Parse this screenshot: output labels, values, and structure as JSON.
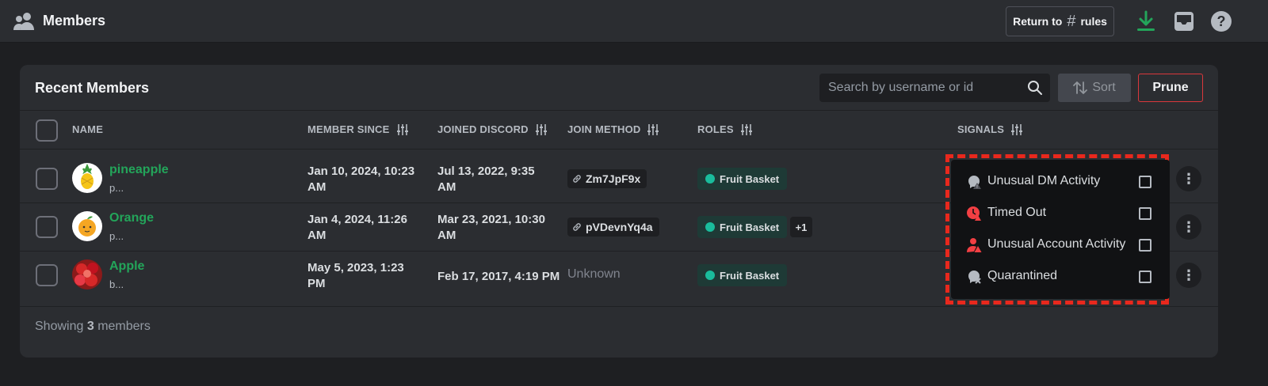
{
  "header": {
    "title": "Members",
    "return_prefix": "Return to",
    "return_channel": "rules",
    "icons": [
      "members-icon",
      "download-icon",
      "inbox-icon",
      "help-icon"
    ]
  },
  "panel": {
    "title": "Recent Members",
    "search_placeholder": "Search by username or id",
    "sort_label": "Sort",
    "prune_label": "Prune"
  },
  "columns": {
    "name": "NAME",
    "member_since": "MEMBER SINCE",
    "joined_discord": "JOINED DISCORD",
    "join_method": "JOIN METHOD",
    "roles": "ROLES",
    "signals": "SIGNALS"
  },
  "rows": [
    {
      "username": "pineapple",
      "subtext": "p...",
      "member_since_1": "Jan 10, 2024, 10:23",
      "member_since_2": "AM",
      "joined_1": "Jul 13, 2022, 9:35",
      "joined_2": "AM",
      "invite": "Zm7JpF9x",
      "role": "Fruit Basket",
      "extra_roles": ""
    },
    {
      "username": "Orange",
      "subtext": "p...",
      "member_since_1": "Jan 4, 2024, 11:26",
      "member_since_2": "AM",
      "joined_1": "Mar 23, 2021, 10:30",
      "joined_2": "AM",
      "invite": "pVDevnYq4a",
      "role": "Fruit Basket",
      "extra_roles": "+1"
    },
    {
      "username": "Apple",
      "subtext": "b...",
      "member_since_1": "May 5, 2023, 1:23",
      "member_since_2": "PM",
      "joined_1": "Feb 17, 2017, 4:19 PM",
      "joined_2": "",
      "invite": "Unknown",
      "role": "Fruit Basket",
      "extra_roles": ""
    }
  ],
  "footer": {
    "prefix": "Showing",
    "count": "3",
    "suffix": "members"
  },
  "signals_menu": [
    {
      "label": "Unusual DM Activity",
      "icon": "unusual-dm-activity-icon",
      "color": "#b5bac1"
    },
    {
      "label": "Timed Out",
      "icon": "timed-out-icon",
      "color": "#f23f43"
    },
    {
      "label": "Unusual Account Activity",
      "icon": "unusual-account-activity-icon",
      "color": "#f23f43"
    },
    {
      "label": "Quarantined",
      "icon": "quarantined-icon",
      "color": "#b5bac1"
    }
  ],
  "colors": {
    "username": "#23a55a",
    "role_dot": "#1abc9c",
    "danger": "#da373c",
    "download": "#23a55a"
  }
}
